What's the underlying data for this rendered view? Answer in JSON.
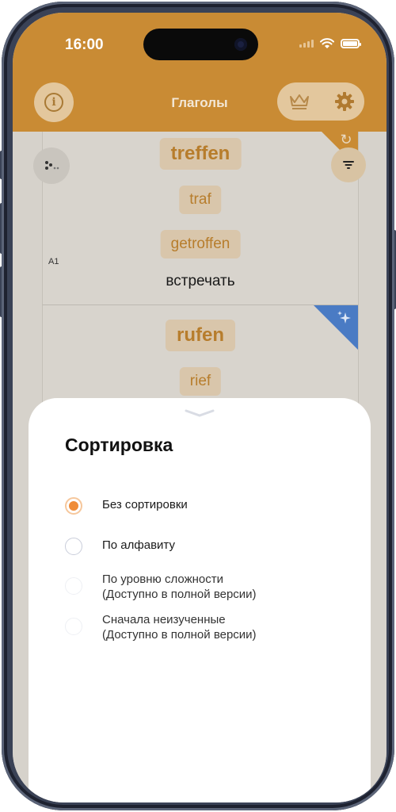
{
  "status_bar": {
    "time": "16:00"
  },
  "header": {
    "title": "Глаголы"
  },
  "cards": [
    {
      "word": "treffen",
      "past": "traf",
      "participle": "getroffen",
      "translation": "встречать",
      "level": "A1"
    },
    {
      "word": "rufen",
      "past": "rief"
    }
  ],
  "sort_sheet": {
    "title": "Сортировка",
    "options": [
      {
        "label": "Без сортировки",
        "selected": true,
        "enabled": true
      },
      {
        "label": "По алфавиту",
        "selected": false,
        "enabled": true
      },
      {
        "label": "По уровню сложности",
        "note": "(Доступно в полной версии)",
        "selected": false,
        "enabled": false
      },
      {
        "label": "Сначала неизученные",
        "note": "(Доступно в полной версии)",
        "selected": false,
        "enabled": false
      }
    ]
  },
  "colors": {
    "accent": "#c98b34",
    "radio_selected": "#ef8c38",
    "new_badge": "#4a7bc4"
  }
}
